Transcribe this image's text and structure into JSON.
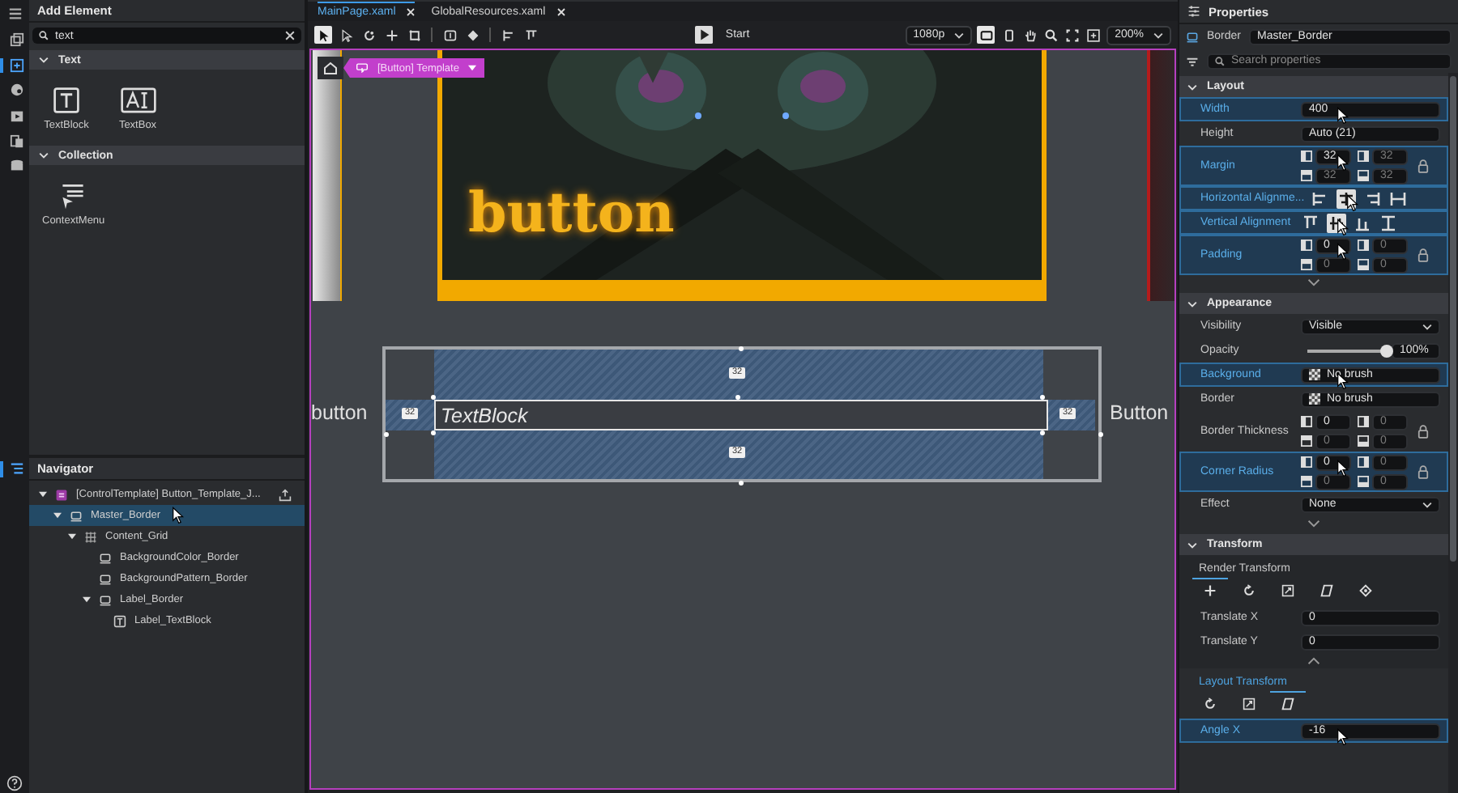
{
  "activity_bar": [
    {
      "selected": false
    },
    {
      "selected": true
    },
    {
      "selected": false
    },
    {
      "selected": false
    },
    {
      "selected": false
    },
    {
      "selected": false
    }
  ],
  "add_element": {
    "title": "Add Element",
    "search": {
      "value": "text"
    },
    "sections": [
      {
        "title": "Text",
        "expanded": true,
        "items": [
          {
            "label": "TextBlock",
            "kind": "textblock"
          },
          {
            "label": "TextBox",
            "kind": "textbox"
          }
        ]
      },
      {
        "title": "Collection",
        "expanded": true,
        "items": [
          {
            "label": "ContextMenu",
            "kind": "menu"
          }
        ]
      }
    ]
  },
  "navigator": {
    "title": "Navigator",
    "selected": true,
    "tree": [
      {
        "label": "[ControlTemplate] Button_Template_J...",
        "kind": "template",
        "expanded": true,
        "selected": false,
        "children": [
          {
            "label": "Master_Border",
            "kind": "border",
            "expanded": true,
            "selected": true,
            "cursor": true,
            "children": [
              {
                "label": "Content_Grid",
                "kind": "grid",
                "expanded": true,
                "selected": false,
                "children": [
                  {
                    "label": "BackgroundColor_Border",
                    "kind": "border",
                    "selected": false
                  },
                  {
                    "label": "BackgroundPattern_Border",
                    "kind": "border",
                    "selected": false
                  },
                  {
                    "label": "Label_Border",
                    "kind": "border",
                    "expanded": true,
                    "selected": false,
                    "children": [
                      {
                        "label": "Label_TextBlock",
                        "kind": "text",
                        "selected": false
                      }
                    ]
                  }
                ]
              }
            ]
          }
        ]
      }
    ]
  },
  "editor": {
    "tabs": [
      {
        "label": "MainPage.xaml",
        "selected": true
      },
      {
        "label": "GlobalResources.xaml",
        "selected": false
      }
    ],
    "tools": [
      {
        "selected": true
      },
      {
        "selected": false
      },
      {
        "selected": false
      },
      {
        "selected": false
      },
      {
        "selected": false
      },
      {
        "selected": false
      },
      {
        "selected": false
      },
      {
        "selected": false
      },
      {
        "selected": false
      }
    ],
    "start": "Start",
    "resolution": "1080p",
    "devices": [
      {
        "selected": true
      },
      {
        "selected": false
      }
    ],
    "zoom": "200%",
    "breadcrumb": "[Button] Template",
    "canvas": {
      "preview_text": "button",
      "selected_text": "TextBlock",
      "side_labels": [
        "button",
        "Button"
      ],
      "margins": [
        "32",
        "32",
        "32",
        "32"
      ]
    }
  },
  "properties": {
    "title": "Properties",
    "type": "Border",
    "name": "Master_Border",
    "search": {
      "placeholder": "Search properties"
    },
    "sections": [
      {
        "title": "Layout",
        "expanded": true,
        "footer": {
          "kind": "expand"
        },
        "rows": [
          {
            "kind": "text",
            "label": "Width",
            "value": "400",
            "highlighted": true,
            "cursor": true
          },
          {
            "kind": "text",
            "label": "Height",
            "value": "Auto (21)",
            "highlighted": false
          },
          {
            "kind": "quad",
            "label": "Margin",
            "values": [
              "32",
              "32",
              "32",
              "32"
            ],
            "highlighted": true,
            "cursor": true
          },
          {
            "kind": "align",
            "label": "Horizontal Alignme...",
            "options": [
              {
                "selected": false
              },
              {
                "selected": true
              },
              {
                "selected": false
              },
              {
                "selected": false
              }
            ],
            "highlighted": true,
            "cursor": true
          },
          {
            "kind": "valign",
            "label": "Vertical Alignment",
            "options": [
              {
                "selected": false
              },
              {
                "selected": true
              },
              {
                "selected": false
              },
              {
                "selected": false
              }
            ],
            "highlighted": true,
            "cursor": true
          },
          {
            "kind": "quad",
            "label": "Padding",
            "values": [
              "0",
              "0",
              "0",
              "0"
            ],
            "highlighted": true,
            "cursor": true
          }
        ]
      },
      {
        "title": "Appearance",
        "expanded": true,
        "footer": {
          "kind": "expand"
        },
        "rows": [
          {
            "kind": "select",
            "label": "Visibility",
            "value": "Visible",
            "highlighted": false
          },
          {
            "kind": "slider",
            "label": "Opacity",
            "level": 1,
            "reading": "100%",
            "highlighted": false
          },
          {
            "kind": "brush",
            "label": "Background",
            "value": "No brush",
            "highlighted": true,
            "cursor": true
          },
          {
            "kind": "brush",
            "label": "Border",
            "value": "No brush",
            "highlighted": false
          },
          {
            "kind": "quad",
            "label": "Border Thickness",
            "values": [
              "0",
              "0",
              "0",
              "0"
            ],
            "highlighted": false
          },
          {
            "kind": "quad",
            "label": "Corner Radius",
            "values": [
              "0",
              "0",
              "0",
              "0"
            ],
            "highlighted": true,
            "cursor": true
          },
          {
            "kind": "select",
            "label": "Effect",
            "value": "None",
            "highlighted": false
          }
        ]
      },
      {
        "title": "Transform",
        "expanded": true,
        "groups": [
          {
            "title": "Render Transform",
            "tabs": [
              {
                "selected": true
              },
              {
                "selected": false
              },
              {
                "selected": false
              },
              {
                "selected": false
              },
              {
                "selected": false
              }
            ],
            "footer": {
              "kind": "collapse"
            },
            "rows": [
              {
                "kind": "text",
                "label": "Translate X",
                "value": "0",
                "highlighted": false
              },
              {
                "kind": "text",
                "label": "Translate Y",
                "value": "0",
                "highlighted": false
              }
            ]
          },
          {
            "title": "Layout Transform",
            "tabs": [
              {
                "selected": false
              },
              {
                "selected": false
              },
              {
                "selected": true
              }
            ],
            "rows": [
              {
                "kind": "text",
                "label": "Angle X",
                "value": "-16",
                "highlighted": true,
                "cursor": true
              }
            ]
          }
        ]
      }
    ]
  }
}
